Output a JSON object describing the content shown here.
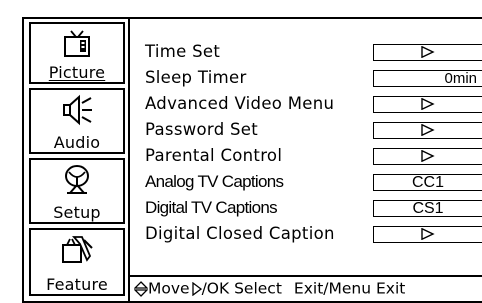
{
  "sidebar": {
    "items": [
      {
        "label": "Picture",
        "icon": "tv-icon",
        "selected": false
      },
      {
        "label": "Audio",
        "icon": "speaker-icon",
        "selected": false
      },
      {
        "label": "Setup",
        "icon": "satellite-dish-icon",
        "selected": false
      },
      {
        "label": "Feature",
        "icon": "tools-icon",
        "selected": true
      }
    ]
  },
  "menu": {
    "items": [
      {
        "label": "Time Set",
        "value": "",
        "arrow": true
      },
      {
        "label": "Sleep Timer",
        "value": "0min",
        "arrow": false
      },
      {
        "label": "Advanced Video Menu",
        "value": "",
        "arrow": true
      },
      {
        "label": "Password Set",
        "value": "",
        "arrow": true
      },
      {
        "label": "Parental Control",
        "value": "",
        "arrow": true
      },
      {
        "label": "Analog TV Captions",
        "value": "CC1",
        "arrow": false
      },
      {
        "label": "Digital TV Captions",
        "value": "CS1",
        "arrow": false
      },
      {
        "label": "Digital Closed Caption",
        "value": "",
        "arrow": true
      }
    ]
  },
  "status": {
    "move": "Move",
    "ok": "/OK Select",
    "exit": "Exit/Menu Exit"
  }
}
